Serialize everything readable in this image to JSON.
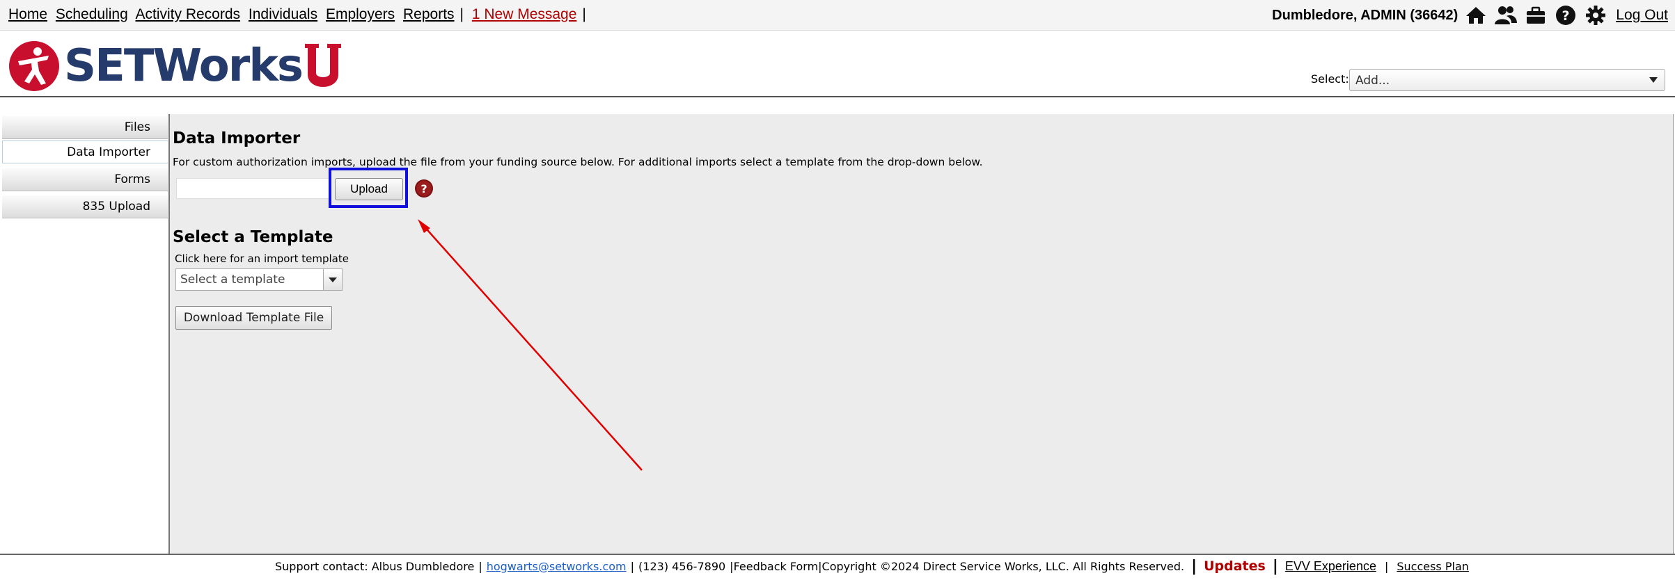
{
  "nav": {
    "links": [
      "Home",
      "Scheduling",
      "Activity Records",
      "Individuals",
      "Employers",
      "Reports"
    ],
    "separator": "|",
    "message": "1 New Message",
    "user": "Dumbledore, ADMIN  (36642)",
    "logout": "Log Out",
    "icons": [
      "home-icon",
      "people-icon",
      "briefcase-icon",
      "help-icon",
      "gear-icon"
    ]
  },
  "header": {
    "logo_text": "SETWorks",
    "select_label": "Select:",
    "select_value": "Add..."
  },
  "sidebar": {
    "items": [
      {
        "label": "Files",
        "active": false
      },
      {
        "label": "Data Importer",
        "active": true
      },
      {
        "label": "Forms",
        "active": false
      },
      {
        "label": "835 Upload",
        "active": false
      }
    ]
  },
  "main": {
    "title": "Data Importer",
    "description": "For custom authorization imports, upload the file from your funding source below. For additional imports select a template from the drop-down below.",
    "upload_label": "Upload",
    "template_title": "Select a Template",
    "template_hint": "Click here for an import template",
    "template_placeholder": "Select a template",
    "download_label": "Download Template File"
  },
  "footer": {
    "support": "Support contact: Albus Dumbledore",
    "email": "hogwarts@setworks.com",
    "phone": "(123) 456-7890",
    "feedback": "Feedback Form",
    "copyright": "Copyright ©2024 Direct Service Works, LLC. All Rights Reserved.",
    "updates": "Updates",
    "evv": "EVV Experience",
    "success": "Success Plan"
  },
  "colors": {
    "highlight_box": "#1010dd",
    "annotation_arrow": "#e00000",
    "brand_red": "#c8102e",
    "brand_navy": "#243b6b"
  }
}
